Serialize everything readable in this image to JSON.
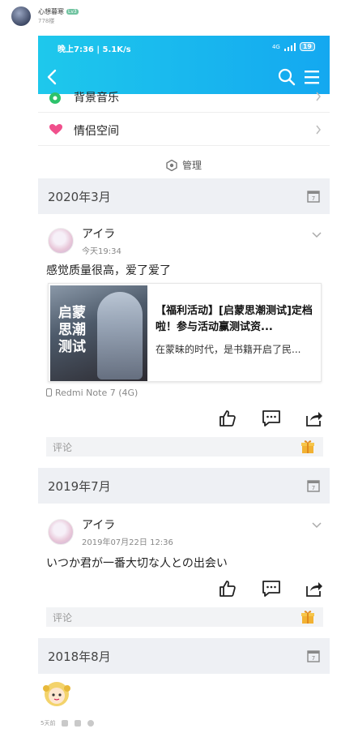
{
  "outer": {
    "user_name": "心想暮寒",
    "level_badge": "Lv3",
    "floor": "778楼",
    "footer_time": "5天前"
  },
  "status": {
    "time_speed": "晚上7:36 | 5.1K/s",
    "network": "4G",
    "battery": "19"
  },
  "menu": {
    "bg_music": "背景音乐",
    "couple_space": "情侣空间",
    "manage": "管理"
  },
  "sections": [
    {
      "month": "2020年3月"
    },
    {
      "month": "2019年7月"
    },
    {
      "month": "2018年8月"
    }
  ],
  "comments": [
    {
      "name": "アイラ",
      "time": "今天19:34",
      "text": "感觉质量很高，爱了爱了",
      "card": {
        "thumb_title": "启蒙思潮测试",
        "title": "【福利活动】[启蒙思潮测试]定档啦！参与活动赢测试资...",
        "desc": "在蒙昧的时代，是书籍开启了民..."
      },
      "device": "Redmi Note 7 (4G)",
      "comment_placeholder": "评论"
    },
    {
      "name": "アイラ",
      "time": "2019年07月22日 12:36",
      "text": "いつか君が一番大切な人との出会い",
      "comment_placeholder": "评论"
    }
  ],
  "colors": {
    "appbar_start": "#1ec8ec",
    "appbar_end": "#14a8f0",
    "section_bg": "#eef0f4",
    "heart": "#f0508c",
    "gift": "#f2b233"
  },
  "icons": [
    "back-arrow-icon",
    "search-icon",
    "menu-icon",
    "heart-icon",
    "settings-hexagon-icon",
    "calendar-icon",
    "chevron-down-icon",
    "thumbs-up-icon",
    "comment-icon",
    "share-icon",
    "gift-icon"
  ]
}
